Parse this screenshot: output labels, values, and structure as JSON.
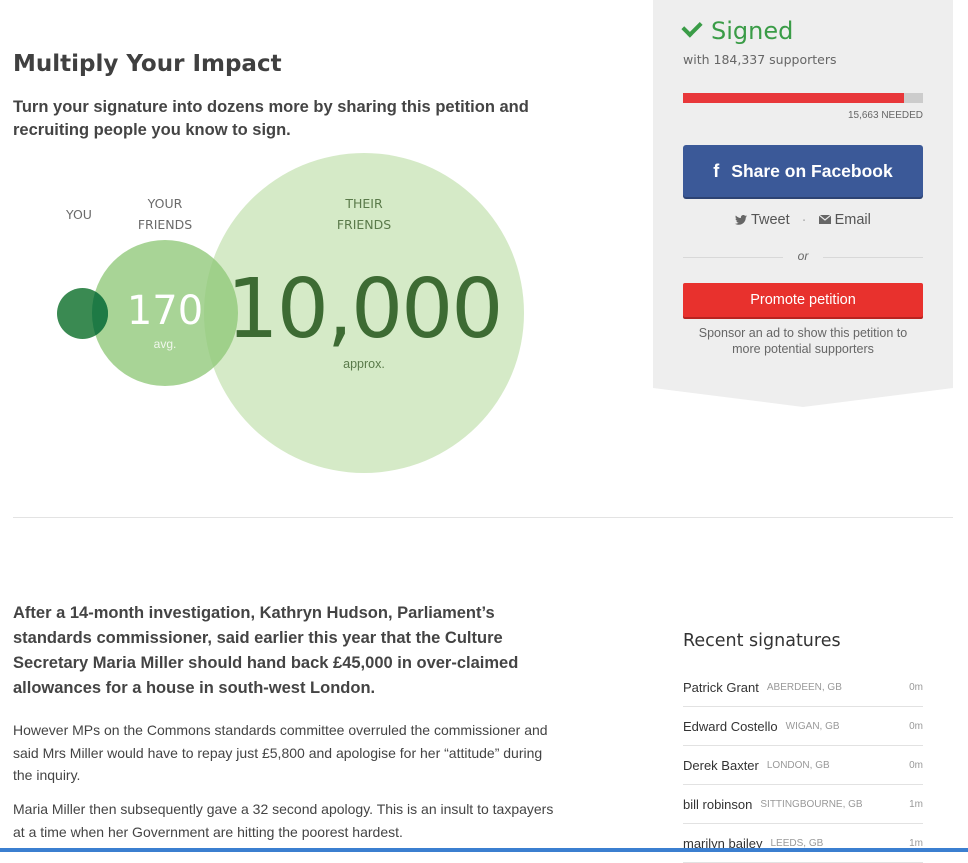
{
  "impact": {
    "title": "Multiply Your Impact",
    "subtitle": "Turn your signature into dozens more by sharing this petition and recruiting people you know to sign.",
    "you_label": "YOU",
    "friends_label_1": "YOUR",
    "friends_label_2": "FRIENDS",
    "their_label_1": "THEIR",
    "their_label_2": "FRIENDS",
    "friends_count": "170",
    "friends_note": "avg.",
    "their_count": "10,000",
    "their_note": "approx."
  },
  "sidebar": {
    "status": "Signed",
    "supporters": "with 184,337 supporters",
    "progress_fraction": 0.92,
    "needed": "15,663 NEEDED",
    "facebook_icon": "f",
    "facebook_label": "Share on Facebook",
    "tweet_label": "Tweet",
    "email_label": "Email",
    "or_label": "or",
    "promote_label": "Promote petition",
    "sponsor_text": "Sponsor an ad to show this petition to more potential supporters"
  },
  "article": {
    "lead": "After a 14-month investigation, Kathryn Hudson, Parliament’s standards commissioner, said earlier this year that the Culture Secretary Maria Miller should hand back £45,000 in over-claimed allowances for a house in south-west London.",
    "p1": "However MPs on the Commons standards committee overruled the commissioner and said Mrs Miller would have to repay just £5,800 and apologise for her “attitude” during the inquiry.",
    "p2": "Maria Miller then subsequently gave a 32 second apology. This is an insult to taxpayers at a time when her Government are hitting the poorest hardest."
  },
  "recent": {
    "title": "Recent signatures",
    "rows": [
      {
        "name": "Patrick Grant",
        "location": "ABERDEEN, GB",
        "time": "0m"
      },
      {
        "name": "Edward Costello",
        "location": "WIGAN, GB",
        "time": "0m"
      },
      {
        "name": "Derek Baxter",
        "location": "LONDON, GB",
        "time": "0m"
      },
      {
        "name": "bill robinson",
        "location": "SITTINGBOURNE, GB",
        "time": "1m"
      },
      {
        "name": "marilyn bailey",
        "location": "LEEDS, GB",
        "time": "1m"
      }
    ]
  },
  "colors": {
    "signed_green": "#3a9c47",
    "facebook_blue": "#3b5998",
    "promote_red": "#e8312d",
    "progress_red": "#e8373a"
  },
  "icons": {
    "check": "check-icon",
    "facebook": "facebook-icon",
    "twitter": "twitter-icon",
    "email": "email-icon"
  }
}
